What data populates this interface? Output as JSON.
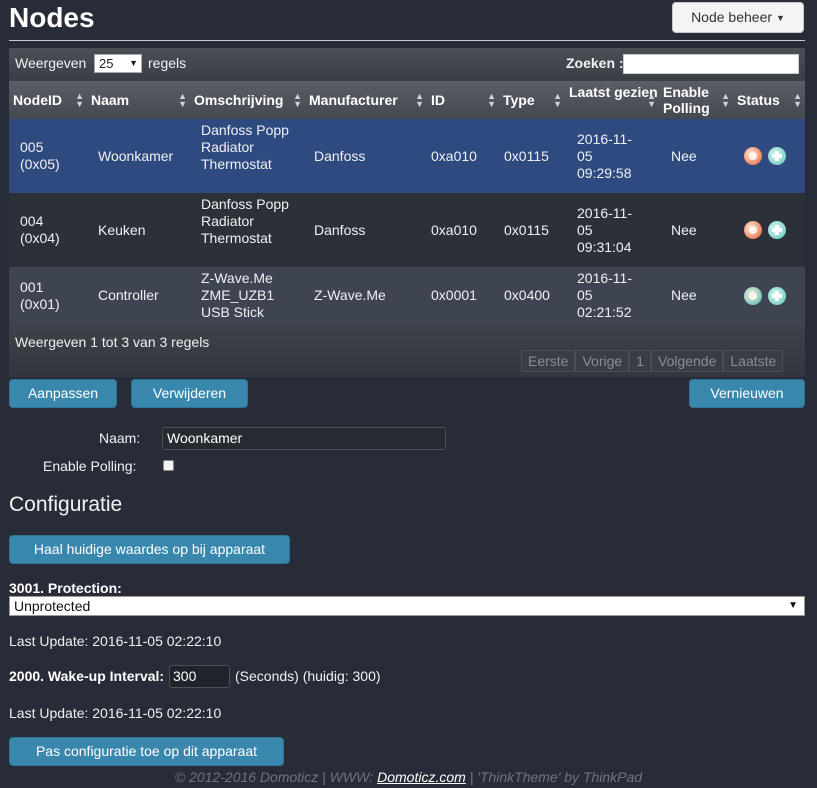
{
  "header": {
    "title": "Nodes",
    "node_menu_label": "Node beheer"
  },
  "table": {
    "length_label_before": "Weergeven",
    "length_value": "25",
    "length_label_after": "regels",
    "search_label": "Zoeken :",
    "search_value": "",
    "columns": [
      "NodeID",
      "Naam",
      "Omschrijving",
      "Manufacturer",
      "ID",
      "Type",
      "Laatst gezien",
      "Enable Polling",
      "Status"
    ],
    "rows": [
      {
        "node_id": "005 (0x05)",
        "name": "Woonkamer",
        "description": "Danfoss Popp Radiator Thermostat",
        "manufacturer": "Danfoss",
        "id": "0xa010",
        "type": "0x0115",
        "last_seen": "2016-11-05 09:29:58",
        "polling": "Nee",
        "status_icon": "sleeping-state-icon",
        "status_color": "#e0531f",
        "selected": true
      },
      {
        "node_id": "004 (0x04)",
        "name": "Keuken",
        "description": "Danfoss Popp Radiator Thermostat",
        "manufacturer": "Danfoss",
        "id": "0xa010",
        "type": "0x0115",
        "last_seen": "2016-11-05 09:31:04",
        "polling": "Nee",
        "status_icon": "sleeping-state-icon",
        "status_color": "#e0531f",
        "selected": false
      },
      {
        "node_id": "001 (0x01)",
        "name": "Controller",
        "description": "Z-Wave.Me ZME_UZB1 USB Stick",
        "manufacturer": "Z-Wave.Me",
        "id": "0x0001",
        "type": "0x0400",
        "last_seen": "2016-11-05 02:21:52",
        "polling": "Nee",
        "status_icon": "awake-state-icon",
        "status_color": "#3fb3a5",
        "selected": false
      }
    ],
    "info": "Weergeven 1 tot 3 van 3 regels",
    "pagination": {
      "first": "Eerste",
      "prev": "Vorige",
      "page": "1",
      "next": "Volgende",
      "last": "Laatste"
    }
  },
  "actions": {
    "edit": "Aanpassen",
    "delete": "Verwijderen",
    "refresh": "Vernieuwen"
  },
  "form": {
    "name_label": "Naam:",
    "name_value": "Woonkamer",
    "polling_label": "Enable Polling:",
    "polling_checked": false
  },
  "config": {
    "title": "Configuratie",
    "fetch_button": "Haal huidige waardes op bij apparaat",
    "protection_label": "3001. Protection:",
    "protection_value": "Unprotected",
    "protection_last_update": "Last Update: 2016-11-05 02:22:10",
    "wakeup_label": "2000. Wake-up Interval:",
    "wakeup_value": "300",
    "wakeup_suffix": "(Seconds) (huidig: 300)",
    "wakeup_last_update": "Last Update: 2016-11-05 02:22:10",
    "apply_button": "Pas configuratie toe op dit apparaat"
  },
  "footer": {
    "prefix": "© 2012-2016 Domoticz | WWW: ",
    "link": "Domoticz.com",
    "suffix": " | 'ThinkTheme' by ThinkPad"
  },
  "colors": {
    "background": "#272c38",
    "accent_button": "#3a87ad",
    "selected_row": "#2f4a7f"
  }
}
